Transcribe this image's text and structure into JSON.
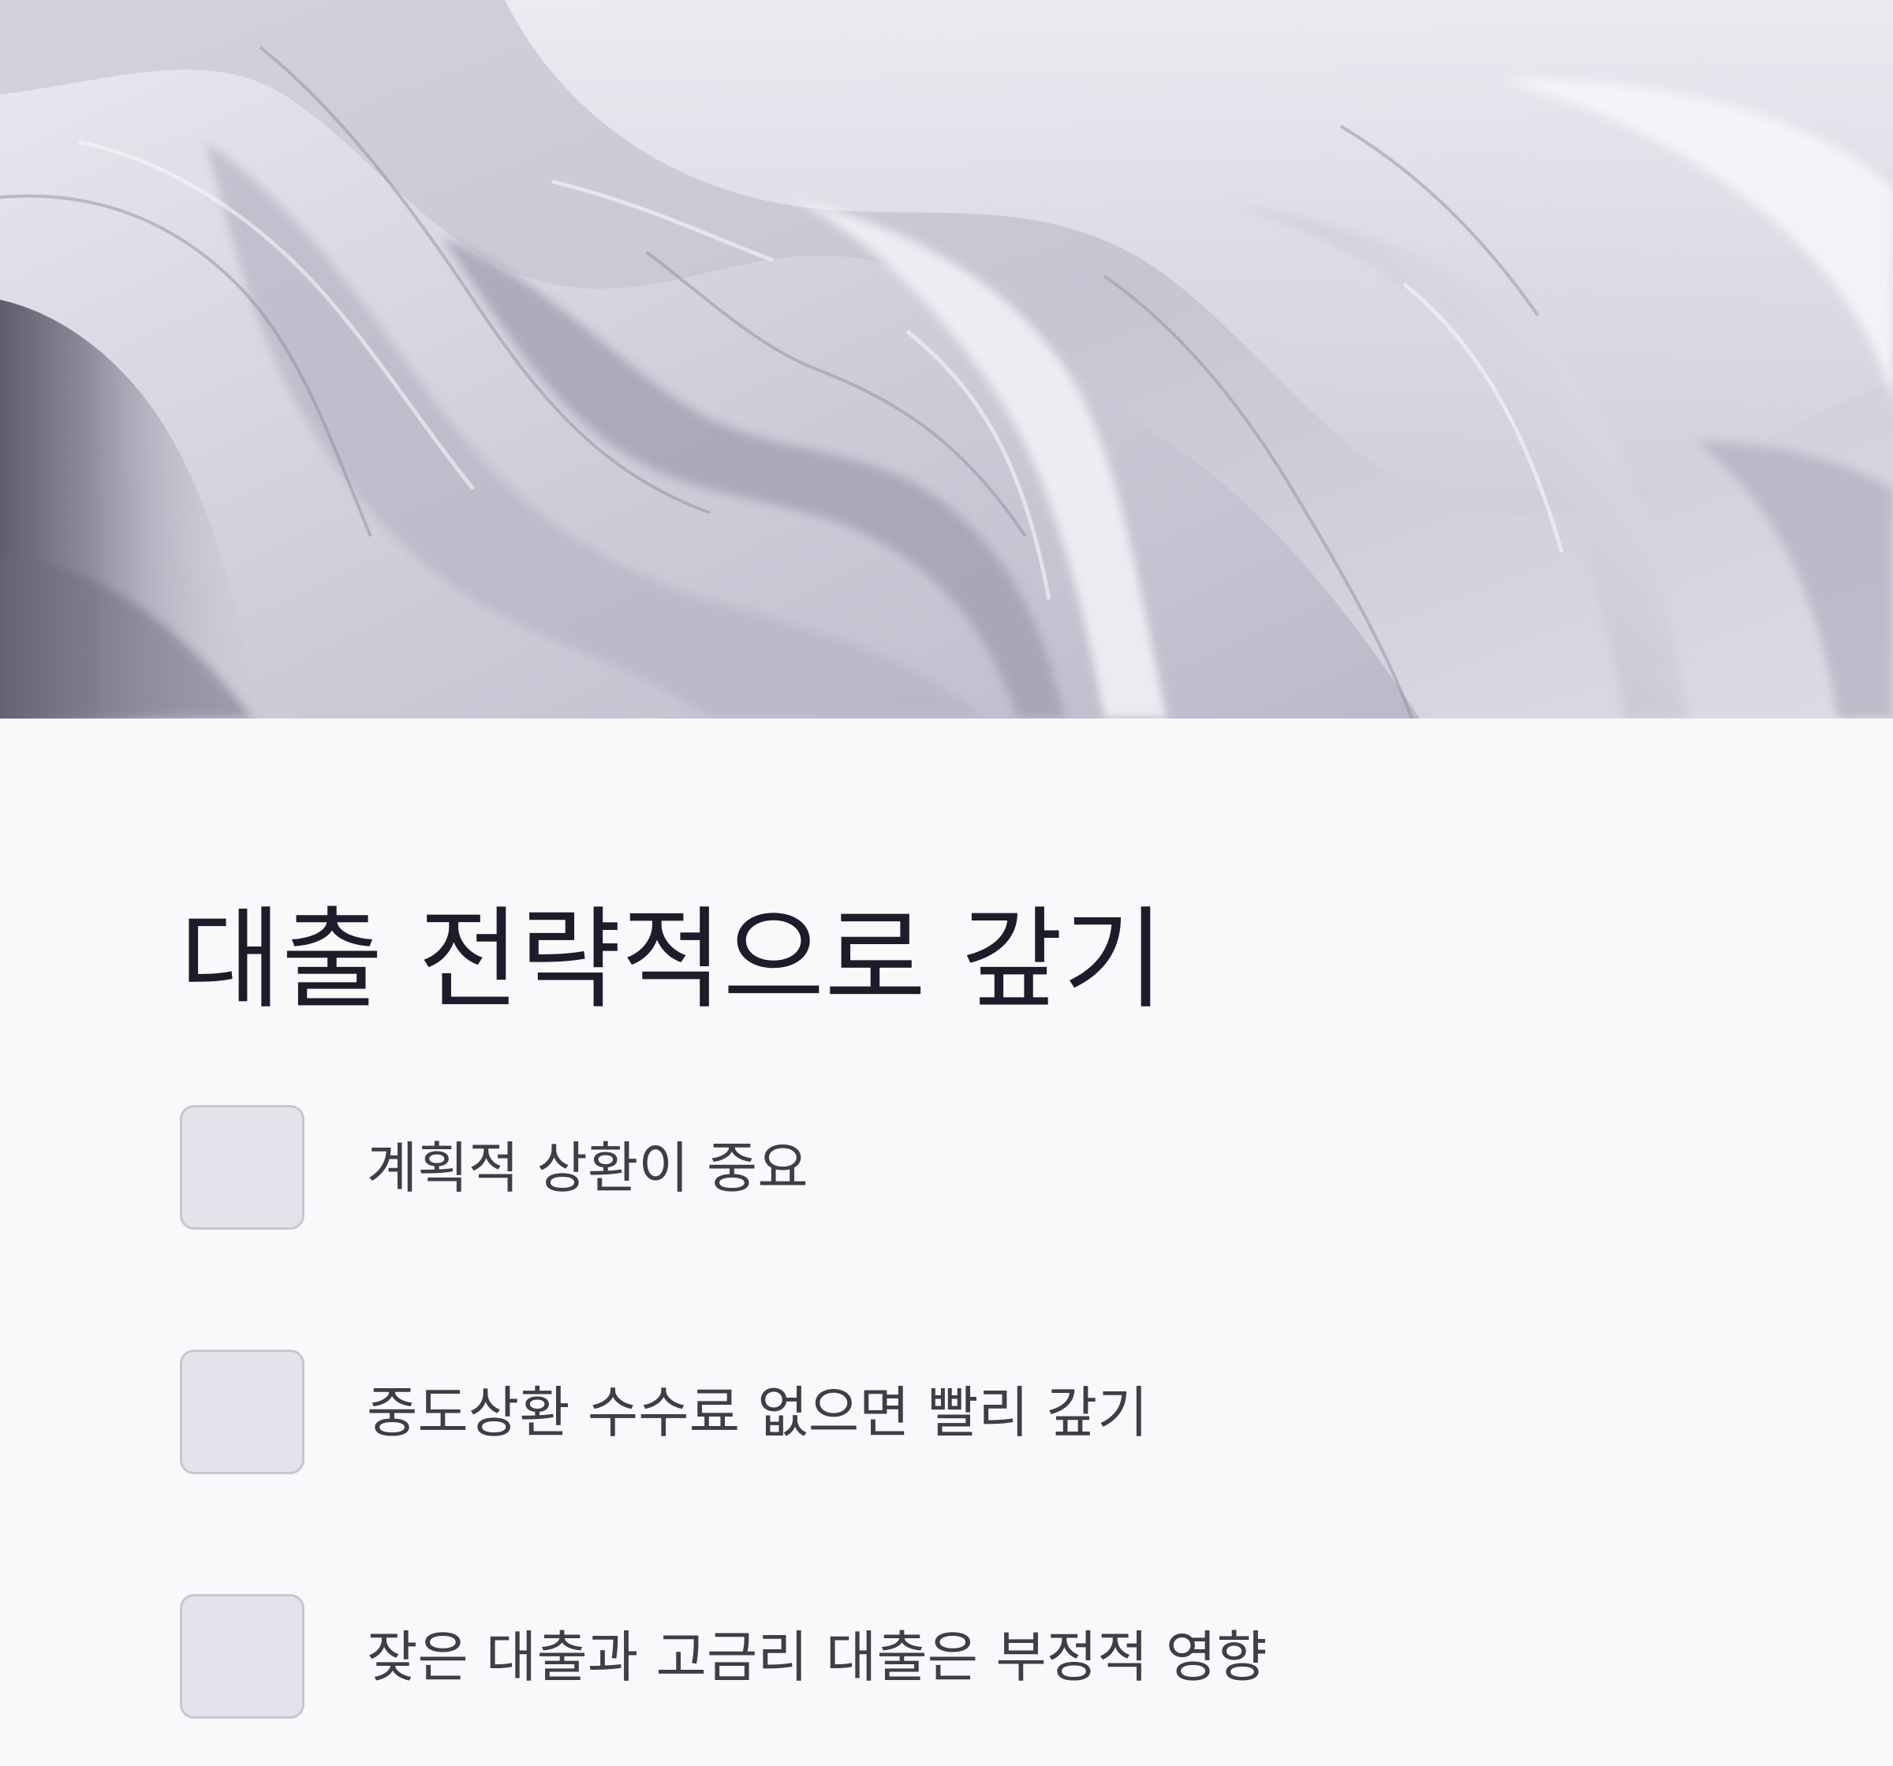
{
  "hero": {
    "image": "abstract-white-silk-waves",
    "colors": {
      "light": "#ececf3",
      "mid": "#c4c4d2",
      "shadow": "#8c8c9c",
      "deep": "#5c5c6b"
    }
  },
  "section": {
    "title": "대출 전략적으로 갚기",
    "items": [
      {
        "label": "계획적 상환이 중요",
        "checked": false
      },
      {
        "label": "중도상환 수수료 없으면 빨리 갚기",
        "checked": false
      },
      {
        "label": "잦은 대출과 고금리 대출은 부정적 영향",
        "checked": false
      }
    ]
  },
  "colors": {
    "background": "#f9f9fb",
    "title_text": "#1c1c2a",
    "item_text": "#3e3e48",
    "checkbox_fill": "#e3e3eb",
    "checkbox_border": "#c7c7d1"
  }
}
